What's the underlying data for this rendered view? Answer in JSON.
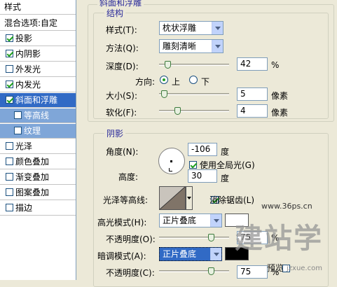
{
  "left_panel": {
    "header": "样式",
    "blend_options": "混合选项:自定",
    "items": [
      {
        "label": "投影",
        "checked": true
      },
      {
        "label": "内阴影",
        "checked": true
      },
      {
        "label": "外发光",
        "checked": false
      },
      {
        "label": "内发光",
        "checked": true
      },
      {
        "label": "斜面和浮雕",
        "checked": true,
        "selected": true
      },
      {
        "label": "等高线",
        "checked": false,
        "sub": true
      },
      {
        "label": "纹理",
        "checked": false,
        "sub": true
      },
      {
        "label": "光泽",
        "checked": false
      },
      {
        "label": "颜色叠加",
        "checked": false
      },
      {
        "label": "渐变叠加",
        "checked": false
      },
      {
        "label": "图案叠加",
        "checked": false
      },
      {
        "label": "描边",
        "checked": false
      }
    ]
  },
  "bevel": {
    "section_title": "斜面和浮雕",
    "structure_title": "结构",
    "style_label": "样式(T):",
    "style_value": "枕状浮雕",
    "technique_label": "方法(Q):",
    "technique_value": "雕刻清晰",
    "depth_label": "深度(D):",
    "depth_value": "42",
    "depth_unit": "%",
    "depth_level_pct": 42,
    "direction_label": "方向:",
    "direction_up": "上",
    "direction_down": "下",
    "size_label": "大小(S):",
    "size_value": "5",
    "size_unit": "像素",
    "soften_label": "软化(F):",
    "soften_value": "4",
    "soften_unit": "像素"
  },
  "shading": {
    "title": "阴影",
    "angle_label": "角度(N):",
    "angle_value": "-106",
    "angle_unit": "度",
    "global_light_label": "使用全局光(G)",
    "altitude_label": "高度:",
    "altitude_value": "30",
    "altitude_unit": "度",
    "gloss_contour_label": "光泽等高线:",
    "anti_alias_label": "消除锯齿(L)",
    "highlight_mode_label": "高光模式(H):",
    "highlight_mode_value": "正片叠底",
    "highlight_color": "#ffffff",
    "opacity1_label": "不透明度(O):",
    "opacity1_value": "75",
    "opacity_unit": "%",
    "shadow_mode_label": "暗调模式(A):",
    "shadow_mode_value": "正片叠底",
    "shadow_color": "#000000",
    "opacity2_label": "不透明度(C):",
    "opacity2_value": "75"
  },
  "watermark": {
    "site": "www.36ps.cn",
    "logo_text": "建站学",
    "preview": "预览",
    "url": "jzxue.com"
  }
}
